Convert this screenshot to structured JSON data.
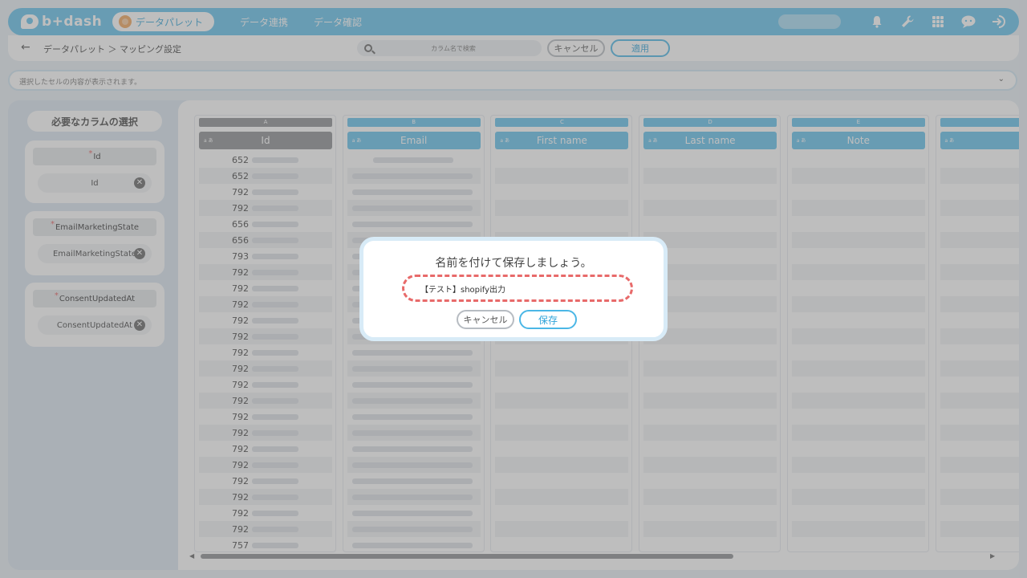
{
  "header": {
    "logo_text": "b+dash",
    "active_nav": "データパレット",
    "nav_links": [
      "データ連携",
      "データ確認"
    ],
    "icons": [
      "bell-icon",
      "wrench-icon",
      "grid-icon",
      "chat-icon",
      "logout-icon"
    ]
  },
  "subbar": {
    "breadcrumb": "データパレット ＞ マッピング設定",
    "search_placeholder": "カラム名で検索",
    "cancel_label": "キャンセル",
    "apply_label": "適用"
  },
  "infobar": {
    "text": "選択したセルの内容が表示されます。"
  },
  "left_panel": {
    "title": "必要なカラムの選択",
    "required_columns": [
      {
        "label": "Id",
        "value": "Id"
      },
      {
        "label": "EmailMarketingState",
        "value": "EmailMarketingState"
      },
      {
        "label": "ConsentUpdatedAt",
        "value": "ConsentUpdatedAt"
      }
    ]
  },
  "grid": {
    "type_tag": "a あ",
    "columns": [
      {
        "letter": "A",
        "name": "Id"
      },
      {
        "letter": "B",
        "name": "Email"
      },
      {
        "letter": "C",
        "name": "First name"
      },
      {
        "letter": "D",
        "name": "Last name"
      },
      {
        "letter": "E",
        "name": "Note"
      },
      {
        "letter": "",
        "name": ""
      }
    ],
    "id_values": [
      "652",
      "652",
      "792",
      "792",
      "656",
      "656",
      "793",
      "792",
      "792",
      "792",
      "792",
      "792",
      "792",
      "792",
      "792",
      "792",
      "792",
      "792",
      "792",
      "792",
      "792",
      "792",
      "792",
      "792",
      "757"
    ]
  },
  "modal": {
    "title": "名前を付けて保存しましょう。",
    "input_value": "【テスト】shopify出力",
    "cancel_label": "キャンセル",
    "save_label": "保存"
  }
}
